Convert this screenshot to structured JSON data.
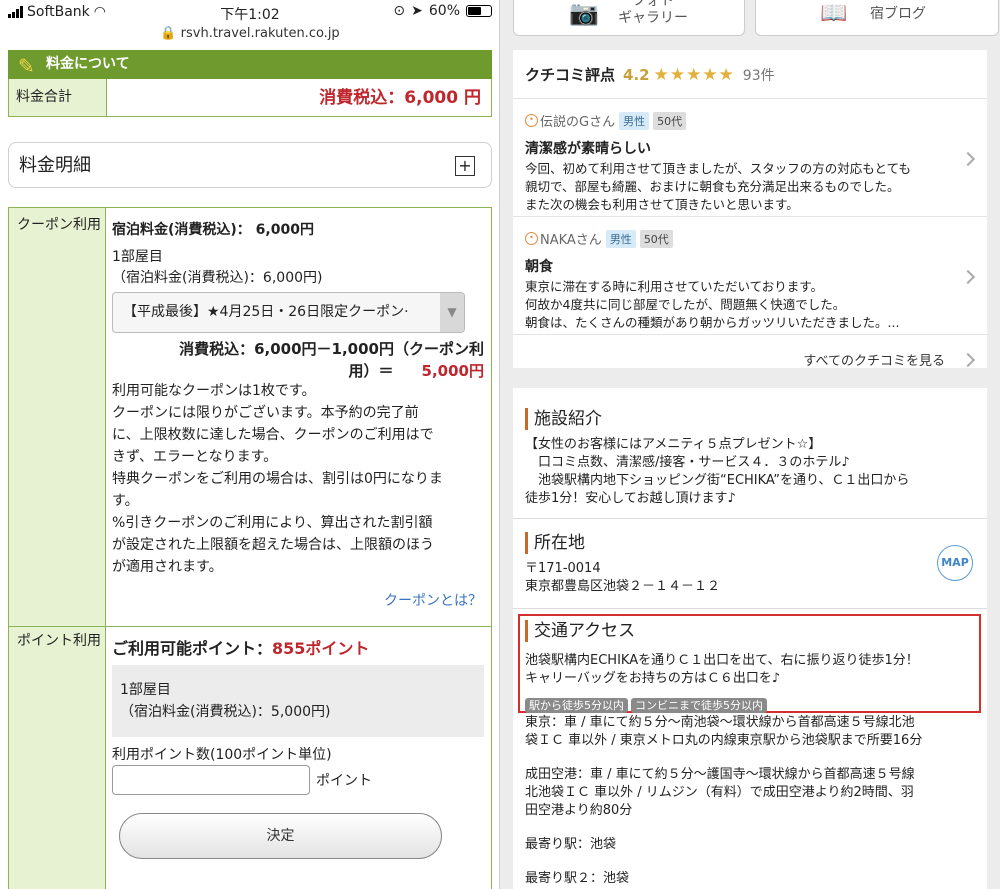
{
  "status_bar": {
    "carrier": "SoftBank",
    "time": "下午1:02",
    "battery": "60%"
  },
  "url": "rsvh.travel.rakuten.co.jp",
  "left": {
    "section_title": "料金について",
    "total_label": "料金合計",
    "total_value": "消費税込：6,000 円",
    "detail_label": "料金明細",
    "detail_plus": "+",
    "coupon_label": "クーポン利用",
    "room_fee": "宿泊料金(消費税込)：  6,000円",
    "room_no": "1部屋目",
    "room_fee_sub": "（宿泊料金(消費税込)：6,000円)",
    "coupon_select": "【平成最後】★4月25日・26日限定クーポン·",
    "calc_line1": "消費税込：6,000円－1,000円（クーポン利",
    "calc_line2": "用）＝",
    "calc_result": "5,000円",
    "notes": [
      "利用可能なクーポンは1枚です。",
      "クーポンには限りがございます。本予約の完了前",
      "に、上限枚数に達した場合、クーポンのご利用はで",
      "きず、エラーとなります。",
      "特典クーポンをご利用の場合は、割引は0円になりま",
      "す。",
      "%引きクーポンのご利用により、算出された割引額",
      "が設定された上限額を超えた場合は、上限額のほう",
      "が適用されます。"
    ],
    "coupon_link": "クーポンとは？",
    "point_label": "ポイント利用",
    "points_title": "ご利用可能ポイント：",
    "points_value": "855ポイント",
    "points_room": "1部屋目",
    "points_fee": "（宿泊料金(消費税込)：5,000円)",
    "points_input_label": "利用ポイント数(100ポイント単位)",
    "points_input_value": "",
    "points_unit": "ポイント",
    "decide_button": "決定"
  },
  "right": {
    "photo_button": "フォト\nギャラリー",
    "blog_button": "宿ブログ",
    "reviews": {
      "header": "クチコミ評点",
      "score": "4.2",
      "stars": "★★★★★",
      "count": "93件",
      "items": [
        {
          "name": "伝説のGさん",
          "gender": "男性",
          "age": "50代",
          "title": "清潔感が素晴らしい",
          "text": "今回、初めて利用させて頂きましたが、スタッフの方の対応もとても\n親切で、部屋も綺麗、おまけに朝食も充分満足出来るものでした。\nまた次の機会も利用させて頂きたいと思います。"
        },
        {
          "name": "NAKAさん",
          "gender": "男性",
          "age": "50代",
          "title": "朝食",
          "text": "東京に滞在する時に利用させていただいております。\n何故か4度共に同じ部屋でしたが、問題無く快適でした。\n朝食は、たくさんの種類があり朝からガッツリいただきました。..."
        }
      ],
      "see_all": "すべてのクチコミを見る"
    },
    "facility": {
      "title": "施設紹介",
      "text": "【女性のお客様にはアメニティ５点プレゼント☆】\n　口コミ点数、清潔感/接客・サービス４．３のホテル♪\n　池袋駅構内地下ショッピング街“ECHIKA”を通り、Ｃ１出口から\n徒歩1分！安心してお越し頂けます♪"
    },
    "location": {
      "title": "所在地",
      "text": "〒171-0014\n東京都豊島区池袋２－１４－１２",
      "map": "MAP"
    },
    "access": {
      "title": "交通アクセス",
      "text": "池袋駅構内ECHIKAを通りＣ１出口を出て、右に振り返り徒歩1分！\nキャリーバッグをお持ちの方はＣ６出口を♪",
      "tags": [
        "駅から徒歩5分以内",
        "コンビニまで徒歩5分以内"
      ],
      "tokyo": "東京：車 / 車にて約５分～南池袋～環状線から首都高速５号線北池\n袋ＩＣ 車以外 / 東京メトロ丸の内線東京駅から池袋駅まで所要16分",
      "narita": "成田空港：車 / 車にて約５分～護国寺～環状線から首都高速５号線\n北池袋ＩＣ 車以外 / リムジン（有料）で成田空港より約2時間、羽\n田空港より約80分",
      "nearest1": "最寄り駅：池袋",
      "nearest2": "最寄り駅２：池袋"
    }
  }
}
